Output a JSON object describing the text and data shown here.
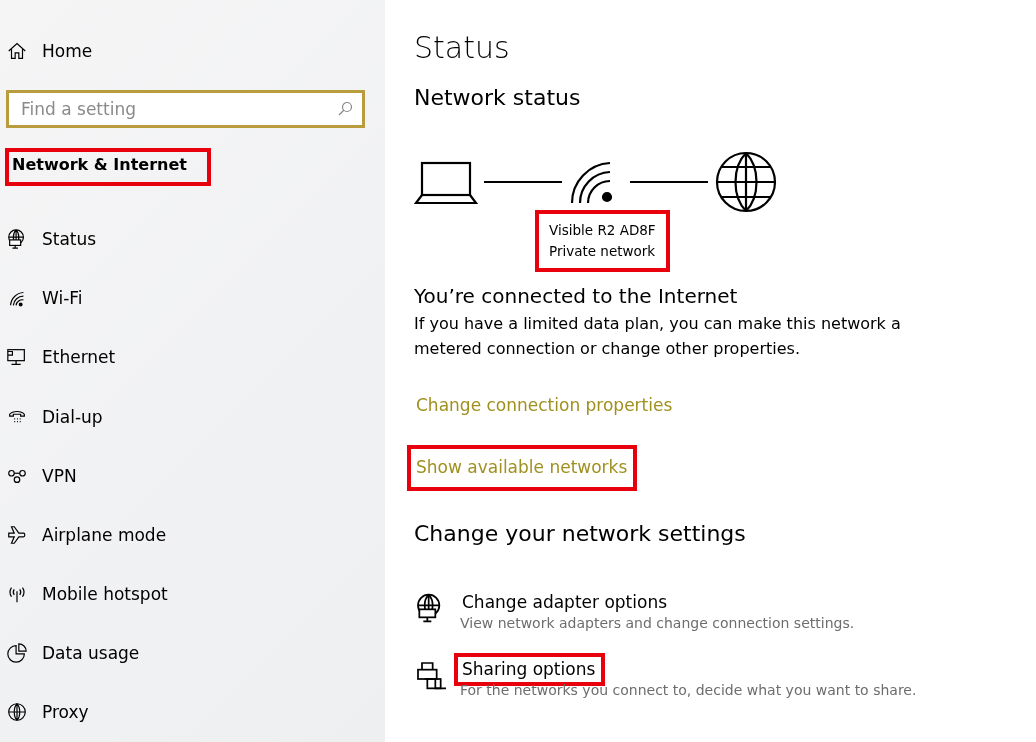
{
  "sidebar": {
    "home": {
      "label": "Home",
      "kind": "home"
    },
    "search": {
      "placeholder": "Find a setting"
    },
    "section": {
      "title": "Network & Internet",
      "highlighted": true
    },
    "items": [
      {
        "label": "Status",
        "kind": "status"
      },
      {
        "label": "Wi-Fi",
        "kind": "wifi"
      },
      {
        "label": "Ethernet",
        "kind": "ethernet"
      },
      {
        "label": "Dial-up",
        "kind": "dialup"
      },
      {
        "label": "VPN",
        "kind": "vpn"
      },
      {
        "label": "Airplane mode",
        "kind": "airplane"
      },
      {
        "label": "Mobile hotspot",
        "kind": "hotspot"
      },
      {
        "label": "Data usage",
        "kind": "data"
      },
      {
        "label": "Proxy",
        "kind": "proxy"
      }
    ]
  },
  "main": {
    "title": "Status",
    "network_status": {
      "heading": "Network status",
      "network_name": "Visible R2 AD8F",
      "network_type": "Private network",
      "highlighted": true
    },
    "connected": {
      "heading": "You’re connected to the Internet",
      "text": "If you have a limited data plan, you can make this network a metered connection or change other properties."
    },
    "links": [
      {
        "label": "Change connection properties",
        "highlighted": false
      },
      {
        "label": "Show available networks",
        "highlighted": true
      }
    ],
    "settings": {
      "heading": "Change your network settings",
      "options": [
        {
          "kind": "adapter",
          "title": "Change adapter options",
          "description": "View network adapters and change connection settings.",
          "highlighted": false
        },
        {
          "kind": "sharing",
          "title": "Sharing options",
          "description": "For the networks you connect to, decide what you want to share.",
          "highlighted": true
        }
      ]
    }
  }
}
